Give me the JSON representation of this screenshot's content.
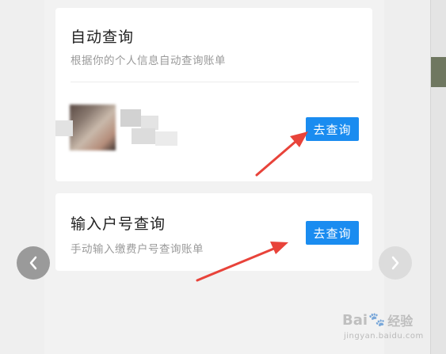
{
  "auto_query": {
    "title": "自动查询",
    "description": "根据你的个人信息自动查询账单",
    "button_label": "去查询"
  },
  "manual_query": {
    "title": "输入户号查询",
    "description": "手动输入缴费户号查询账单",
    "button_label": "去查询"
  },
  "carousel": {
    "prev_icon": "chevron-left",
    "next_icon": "chevron-right"
  },
  "watermark": {
    "brand_prefix": "Bai",
    "brand_suffix": "经验",
    "url": "jingyan.baidu.com"
  },
  "colors": {
    "accent": "#1a8cf0",
    "annotation_arrow": "#e8433a"
  }
}
